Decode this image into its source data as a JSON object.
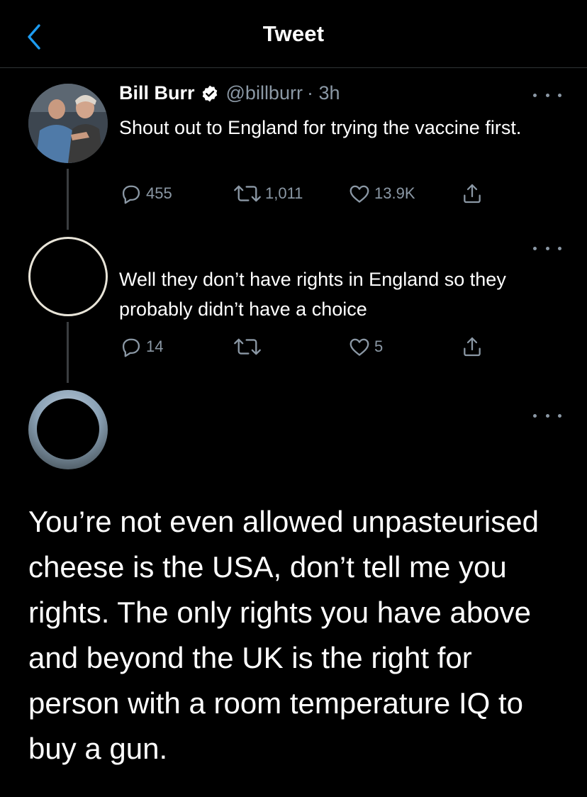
{
  "header": {
    "title": "Tweet",
    "back_icon": "chevron-left-icon",
    "accent": "#1d9bf0"
  },
  "tweets": [
    {
      "author_name": "Bill Burr",
      "verified": true,
      "handle": "@billburr",
      "time": "· 3h",
      "text": "Shout out to England for trying the vaccine first.",
      "replies": "455",
      "retweets": "1,011",
      "likes": "13.9K"
    },
    {
      "text": "Well they don’t have rights in England so they probably didn’t have a choice",
      "replies": "14",
      "retweets": "",
      "likes": "5"
    },
    {
      "text": "You’re not even allowed unpasteurised cheese is the USA, don’t tell me you rights. The only rights you have above and beyond the UK is the right for person with a room temperature IQ to buy a gun."
    }
  ],
  "icons": {
    "reply": "reply-icon",
    "retweet": "retweet-icon",
    "like": "heart-icon",
    "share": "share-icon",
    "more": "more-icon",
    "verified": "verified-badge-icon"
  },
  "colors": {
    "background": "#000000",
    "muted_text": "#8b98a5",
    "divider": "#2f3336"
  }
}
